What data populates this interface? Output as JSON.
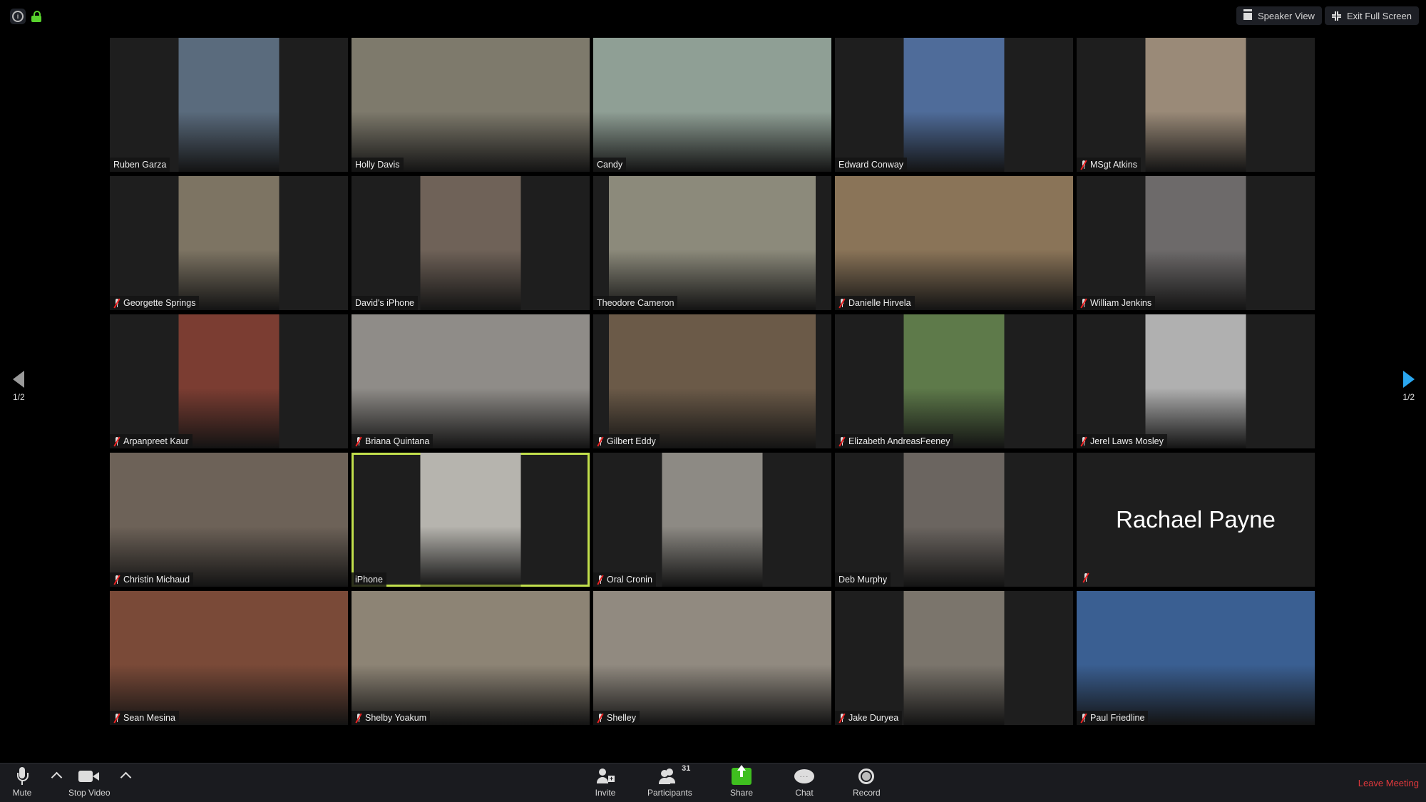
{
  "top_bar": {
    "info_icon": "info-icon",
    "lock_icon": "lock-icon",
    "lock_color": "#58d22d",
    "speaker_view_label": "Speaker View",
    "exit_full_screen_label": "Exit Full Screen"
  },
  "pagination": {
    "left_label": "1/2",
    "right_label": "1/2",
    "active_arrow_color": "#2aa7f0"
  },
  "participants": [
    {
      "name": "Ruben Garza",
      "muted": false,
      "video": "portrait",
      "bg": "#5a6b7d"
    },
    {
      "name": "Holly Davis",
      "muted": false,
      "video": "full",
      "bg": "#7e7a6c"
    },
    {
      "name": "Candy",
      "muted": false,
      "video": "full",
      "bg": "#8f9f95"
    },
    {
      "name": "Edward Conway",
      "muted": false,
      "video": "portrait",
      "bg": "#4f6c9a"
    },
    {
      "name": "MSgt Atkins",
      "muted": true,
      "video": "portrait",
      "bg": "#9a8a78"
    },
    {
      "name": "Georgette Springs",
      "muted": true,
      "video": "portrait",
      "bg": "#7d7463"
    },
    {
      "name": "David's iPhone",
      "muted": false,
      "video": "portrait",
      "bg": "#6f6258"
    },
    {
      "name": "Theodore Cameron",
      "muted": false,
      "video": "wide",
      "bg": "#8c8a7b"
    },
    {
      "name": "Danielle Hirvela",
      "muted": true,
      "video": "full",
      "bg": "#8a7458"
    },
    {
      "name": "William Jenkins",
      "muted": true,
      "video": "portrait",
      "bg": "#6d6a6a"
    },
    {
      "name": "Arpanpreet Kaur",
      "muted": true,
      "video": "portrait",
      "bg": "#7b3d32"
    },
    {
      "name": "Briana Quintana",
      "muted": true,
      "video": "full",
      "bg": "#8f8c88"
    },
    {
      "name": "Gilbert Eddy",
      "muted": true,
      "video": "wide",
      "bg": "#6b5a48"
    },
    {
      "name": "Elizabeth AndreasFeeney",
      "muted": true,
      "video": "portrait",
      "bg": "#5e7a4a"
    },
    {
      "name": "Jerel Laws Mosley",
      "muted": true,
      "video": "portrait",
      "bg": "#b0b0b0"
    },
    {
      "name": "Christin Michaud",
      "muted": true,
      "video": "full",
      "bg": "#6d6258"
    },
    {
      "name": "iPhone",
      "muted": false,
      "video": "portrait",
      "bg": "#b6b4ae",
      "active_speaker": true
    },
    {
      "name": "Oral Cronin",
      "muted": true,
      "video": "portrait",
      "bg": "#8d8a84"
    },
    {
      "name": "Deb Murphy",
      "muted": false,
      "video": "portrait",
      "bg": "#6b6560"
    },
    {
      "name": "Rachael Payne",
      "muted": true,
      "video": "none",
      "bg": "#1e1e1e"
    },
    {
      "name": "Sean Mesina",
      "muted": true,
      "video": "full",
      "bg": "#7a4a38"
    },
    {
      "name": "Shelby Yoakum",
      "muted": true,
      "video": "full",
      "bg": "#8d8475"
    },
    {
      "name": "Shelley",
      "muted": true,
      "video": "full",
      "bg": "#918a80"
    },
    {
      "name": "Jake Duryea",
      "muted": true,
      "video": "portrait",
      "bg": "#7b756c"
    },
    {
      "name": "Paul Friedline",
      "muted": true,
      "video": "full",
      "bg": "#3a5f92"
    }
  ],
  "toolbar": {
    "mute_label": "Mute",
    "stop_video_label": "Stop Video",
    "invite_label": "Invite",
    "participants_label": "Participants",
    "participants_count": "31",
    "share_label": "Share",
    "share_color": "#3fbf1f",
    "chat_label": "Chat",
    "record_label": "Record",
    "leave_label": "Leave Meeting",
    "leave_color": "#e0383c"
  }
}
